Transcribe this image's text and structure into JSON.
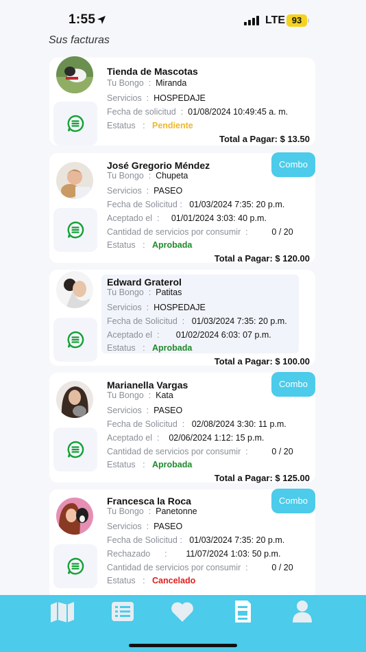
{
  "status_bar": {
    "time": "1:55",
    "network": "LTE",
    "battery": "93"
  },
  "section_title": "Sus facturas",
  "invoices": [
    {
      "name": "Tienda de Mascotas",
      "bongo_label": "Tu Bongo",
      "bongo": "Miranda",
      "service_label": "Servicios",
      "service": "HOSPEDAJE",
      "date_label": "Fecha de solicitud",
      "date": "01/08/2024 10:49:45 a. m.",
      "status_label": "Estatus",
      "status": "Pendiente",
      "total": "Total a Pagar: $ 13.50"
    },
    {
      "name": "José Gregorio Méndez",
      "combo": "Combo",
      "bongo_label": "Tu Bongo",
      "bongo": "Chupeta",
      "service_label": "Servicios",
      "service": "PASEO",
      "date_label": "Fecha de Solicitud",
      "date": "01/03/2024  7:35: 20 p.m.",
      "extra_label": "Aceptado el",
      "extra": "01/01/2024   3:03: 40 p.m.",
      "consume_label": "Cantidad de servicios por consumir",
      "consume": "0  /  20",
      "status_label": "Estatus",
      "status": "Aprobada",
      "total": "Total a Pagar: $ 120.00"
    },
    {
      "name": "Edward Graterol",
      "bongo_label": "Tu Bongo",
      "bongo": "Patitas",
      "service_label": "Servicios",
      "service": "HOSPEDAJE",
      "date_label": "Fecha de Solicitud",
      "date": "01/03/2024  7:35: 20 p.m.",
      "extra_label": "Aceptado el",
      "extra": "01/02/2024  6:03: 07 p.m.",
      "status_label": "Estatus",
      "status": "Aprobada",
      "total": "Total a Pagar: $ 100.00"
    },
    {
      "name": "Marianella Vargas",
      "combo": "Combo",
      "bongo_label": "Tu Bongo",
      "bongo": "Kata",
      "service_label": "Servicios",
      "service": "PASEO",
      "date_label": "Fecha de Solicitud",
      "date": "02/08/2024  3:30: 11 p.m.",
      "extra_label": "Aceptado el",
      "extra": "02/06/2024   1:12: 15 p.m.",
      "consume_label": "Cantidad de servicios por consumir",
      "consume": "0  /  20",
      "status_label": "Estatus",
      "status": "Aprobada",
      "total": "Total a Pagar: $ 125.00"
    },
    {
      "name": "Francesca la Roca",
      "combo": "Combo",
      "bongo_label": "Tu Bongo",
      "bongo": "Panetonne",
      "service_label": "Servicios",
      "service": "PASEO",
      "date_label": "Fecha de Solicitud",
      "date": "01/03/2024  7:35: 20 p.m.",
      "extra_label": "Rechazado",
      "extra": "11/07/2024  1:03: 50 p.m.",
      "consume_label": "Cantidad de servicios por consumir",
      "consume": "0  /  20",
      "status_label": "Estatus",
      "status": "Cancelado"
    }
  ],
  "nav": {
    "items": [
      "map-icon",
      "list-icon",
      "heart-icon",
      "document-icon",
      "user-icon"
    ],
    "active_index": 3
  },
  "colors": {
    "accent": "#4ccbea",
    "pending": "#efb72a",
    "approved": "#1e8a2b",
    "cancelled": "#e01c1c"
  }
}
